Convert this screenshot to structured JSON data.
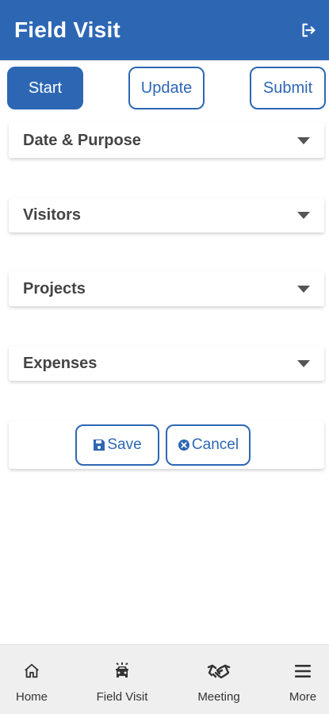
{
  "header": {
    "title": "Field Visit",
    "logout_icon": "logout-icon"
  },
  "tabs": [
    {
      "label": "Start",
      "active": true
    },
    {
      "label": "Update",
      "active": false
    },
    {
      "label": "Submit",
      "active": false
    }
  ],
  "sections": [
    {
      "title": "Date & Purpose"
    },
    {
      "title": "Visitors"
    },
    {
      "title": "Projects"
    },
    {
      "title": "Expenses"
    }
  ],
  "actions": {
    "save_label": "Save",
    "cancel_label": "Cancel"
  },
  "bottom_nav": [
    {
      "label": "Home",
      "icon": "home-icon"
    },
    {
      "label": "Field Visit",
      "icon": "car-icon"
    },
    {
      "label": "Meeting",
      "icon": "handshake-icon"
    },
    {
      "label": "More",
      "icon": "menu-icon"
    }
  ],
  "colors": {
    "primary": "#2d67b4",
    "nav_bg": "#efefef"
  }
}
